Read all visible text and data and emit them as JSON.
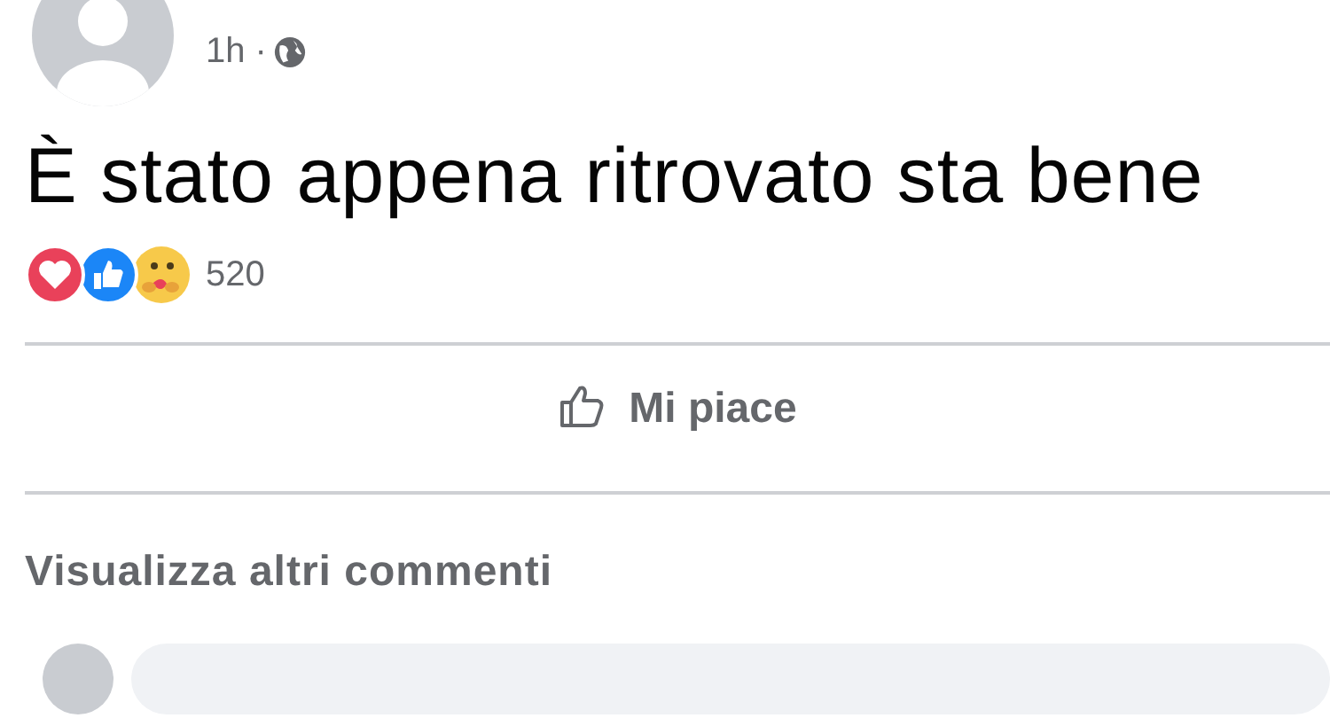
{
  "post": {
    "time": "1h ·",
    "text": "È stato appena ritrovato sta bene",
    "reactions": {
      "count": "520"
    },
    "actions": [
      {
        "kind": "like",
        "label": "Mi piace"
      }
    ],
    "more_comments": "Visualizza altri commenti"
  }
}
